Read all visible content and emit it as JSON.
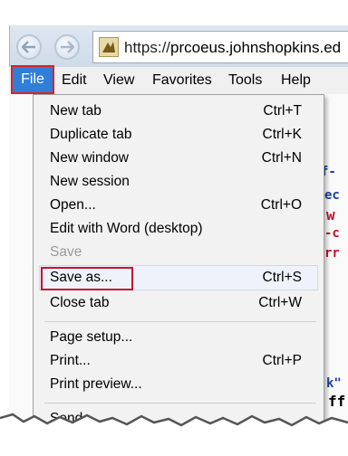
{
  "browser": {
    "url_prefix": "https://",
    "url_host": "prcoeus.johnshopkins.ed",
    "back_icon": "arrow-left-icon",
    "forward_icon": "arrow-right-icon",
    "site_icon": "site-favicon-icon"
  },
  "menubar": {
    "items": [
      {
        "label": "File"
      },
      {
        "label": "Edit"
      },
      {
        "label": "View"
      },
      {
        "label": "Favorites"
      },
      {
        "label": "Tools"
      },
      {
        "label": "Help"
      }
    ]
  },
  "file_menu": {
    "items": [
      {
        "label": "New tab",
        "shortcut": "Ctrl+T"
      },
      {
        "label": "Duplicate tab",
        "shortcut": "Ctrl+K"
      },
      {
        "label": "New window",
        "shortcut": "Ctrl+N"
      },
      {
        "label": "New session",
        "shortcut": ""
      },
      {
        "label": "Open...",
        "shortcut": "Ctrl+O"
      },
      {
        "label": "Edit with Word (desktop)",
        "shortcut": ""
      },
      {
        "label": "Save",
        "shortcut": "",
        "disabled": true
      },
      {
        "label": "Save as...",
        "shortcut": "Ctrl+S",
        "highlighted": true
      },
      {
        "label": "Close tab",
        "shortcut": "Ctrl+W"
      },
      {
        "label": "Page setup...",
        "shortcut": ""
      },
      {
        "label": "Print...",
        "shortcut": "Ctrl+P"
      },
      {
        "label": "Print preview...",
        "shortcut": ""
      },
      {
        "label": "Send",
        "shortcut": ""
      }
    ]
  },
  "page_fragments": [
    {
      "text": "f-",
      "color": "#1a3fa0"
    },
    {
      "text": "ec",
      "color": "#1a3fa0"
    },
    {
      "text": "w",
      "color": "#c8102e"
    },
    {
      "text": "-c",
      "color": "#c8102e"
    },
    {
      "text": "rr",
      "color": "#c8102e"
    },
    {
      "text": "k\"",
      "color": "#1a3fa0"
    },
    {
      "text": "ff",
      "color": "#000000"
    }
  ],
  "colors": {
    "highlight_box": "#c8102e",
    "file_active_bg": "#2f7fd8"
  }
}
